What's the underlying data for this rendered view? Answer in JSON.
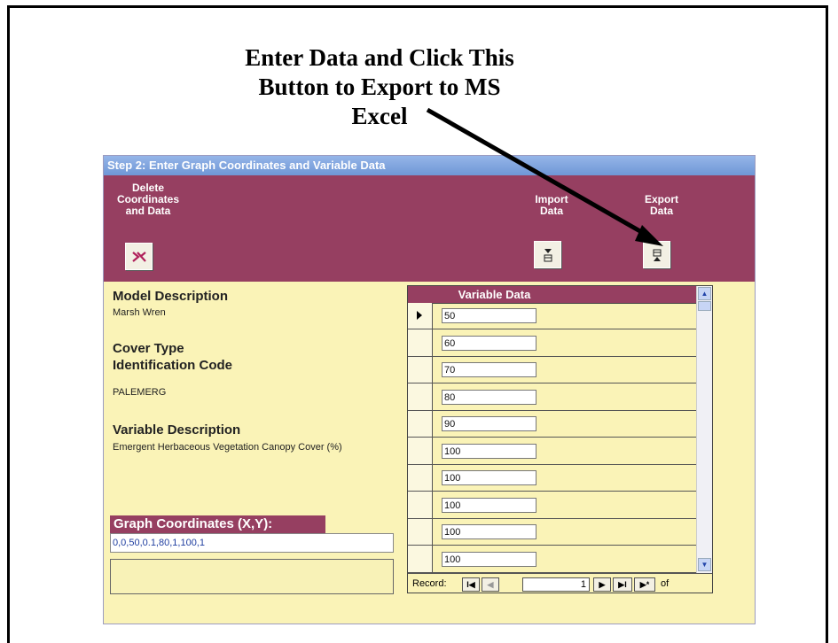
{
  "callout": {
    "line1": "Enter Data and Click This",
    "line2": "Button to Export to MS",
    "line3": "Excel"
  },
  "window": {
    "title": "Step 2: Enter Graph Coordinates and Variable Data"
  },
  "toolbar": {
    "delete_l1": "Delete",
    "delete_l2": "Coordinates",
    "delete_l3": "and Data",
    "import_l1": "Import",
    "import_l2": "Data",
    "export_l1": "Export",
    "export_l2": "Data"
  },
  "icons": {
    "delete": "delete-x-icon",
    "import": "import-table-icon",
    "export": "export-table-icon"
  },
  "form": {
    "model_desc_label": "Model Description",
    "model_desc_value": "Marsh Wren",
    "cover_label_1": "Cover Type",
    "cover_label_2": "Identification Code",
    "cover_value": "PALEMERG",
    "var_desc_label": "Variable Description",
    "var_desc_value": "Emergent Herbaceous Vegetation Canopy Cover  (%)",
    "graph_coords_label": "Graph Coordinates (X,Y):",
    "graph_coords_value": "0,0,50,0.1,80,1,100,1"
  },
  "subform": {
    "header": "Variable Data",
    "rows": [
      "50",
      "60",
      "70",
      "80",
      "90",
      "100",
      "100",
      "100",
      "100",
      "100"
    ]
  },
  "nav": {
    "record_label": "Record:",
    "current": "1",
    "of_label": "of",
    "first": "I◀",
    "prev": "◀",
    "next": "▶",
    "last": "▶I",
    "new": "▶*"
  },
  "colors": {
    "toolbar": "#963f61",
    "form_bg": "#faf3b7",
    "titlebar": "#7aa0dc"
  }
}
